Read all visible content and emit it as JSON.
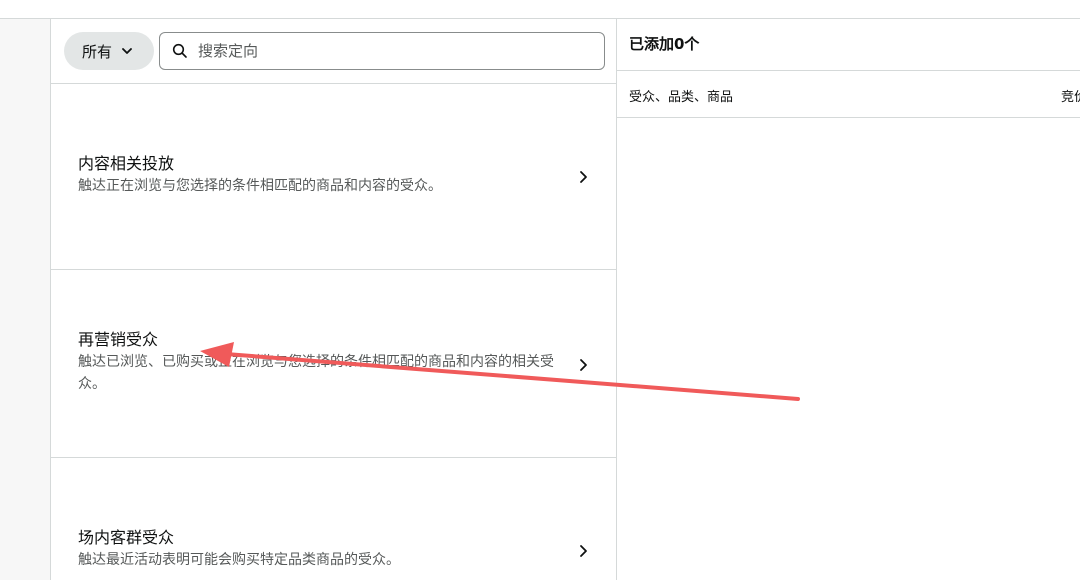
{
  "filter": {
    "label": "所有"
  },
  "search": {
    "placeholder": "搜索定向"
  },
  "targets": [
    {
      "title": "内容相关投放",
      "description": "触达正在浏览与您选择的条件相匹配的商品和内容的受众。"
    },
    {
      "title": "再营销受众",
      "description": "触达已浏览、已购买或正在浏览与您选择的条件相匹配的商品和内容的相关受众。"
    },
    {
      "title": "场内客群受众",
      "description": "触达最近活动表明可能会购买特定品类商品的受众。"
    }
  ],
  "added": {
    "title": "已添加0个"
  },
  "columns": {
    "audience": "受众、品类、商品",
    "bid": "竞价"
  },
  "colors": {
    "annotation_arrow": "#f05a5a",
    "border": "#d5d9d9",
    "pill": "#e3e6e6"
  },
  "icons": [
    "search-icon",
    "chevron-down-icon",
    "chevron-right-icon",
    "annotation-arrow"
  ]
}
